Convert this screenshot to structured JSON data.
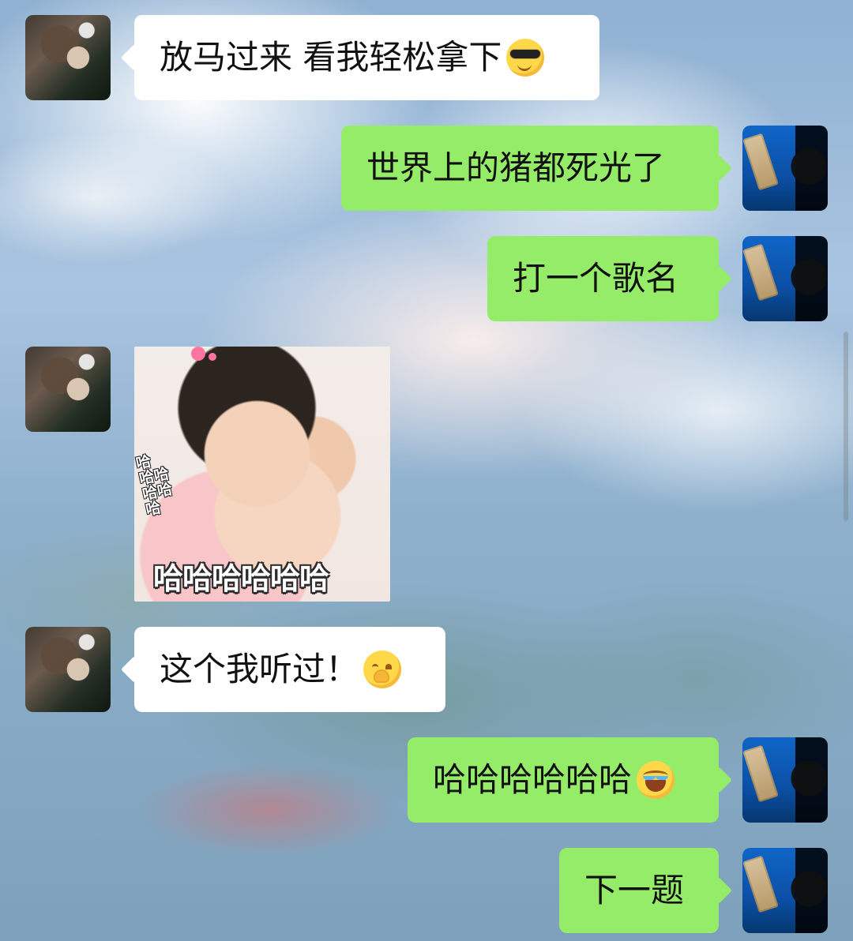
{
  "chat": {
    "messages": [
      {
        "side": "left",
        "text": "放马过来 看我轻松拿下",
        "emoji": "cool-sunglasses-emoji"
      },
      {
        "side": "right",
        "text": "世界上的猪都死光了"
      },
      {
        "side": "right",
        "text": "打一个歌名"
      },
      {
        "side": "left",
        "sticker": {
          "side_text": "哈\n哈哈\n哈哈\n哈",
          "caption": "哈哈哈哈哈哈"
        }
      },
      {
        "side": "left",
        "text": "这个我听过！",
        "emoji": "shushing-face-emoji"
      },
      {
        "side": "right",
        "text": "哈哈哈哈哈哈",
        "emoji": "rolling-laughing-emoji"
      },
      {
        "side": "right",
        "text": "下一题"
      }
    ]
  },
  "colors": {
    "left_bubble": "#ffffff",
    "right_bubble": "#95ec69"
  }
}
